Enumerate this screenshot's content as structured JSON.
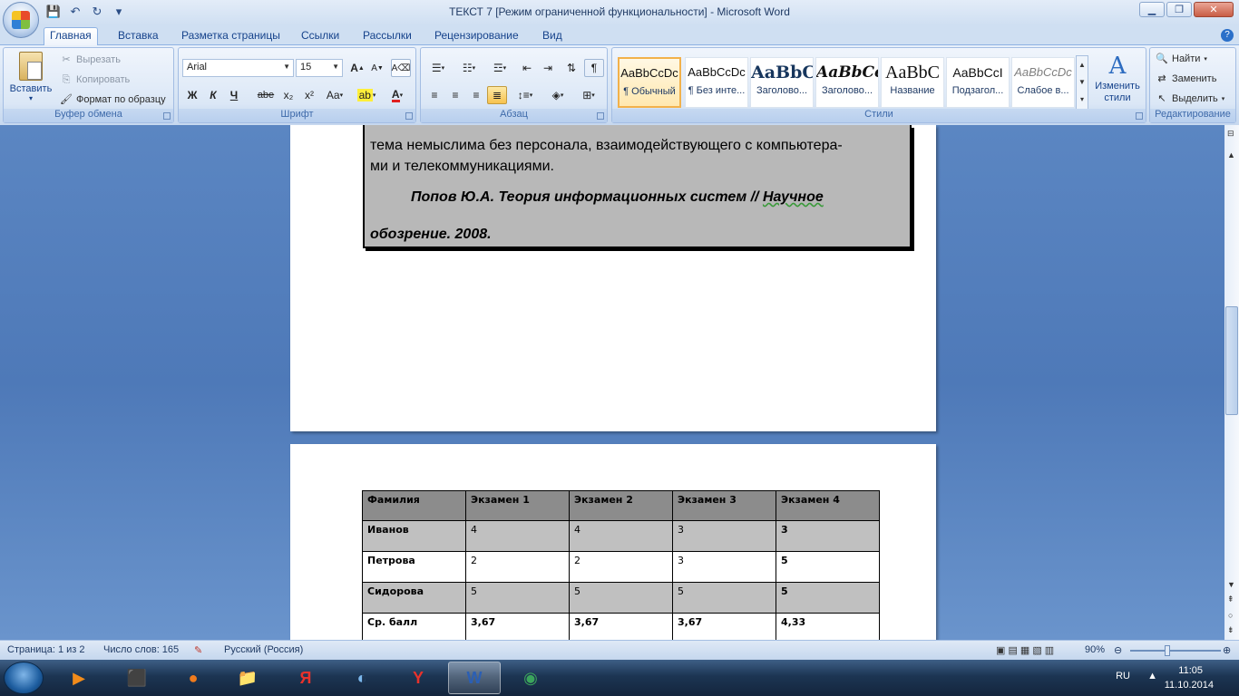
{
  "window": {
    "title": "ТЕКСТ 7 [Режим ограниченной функциональности] - Microsoft Word"
  },
  "qat": {
    "save": "💾",
    "undo": "↶",
    "redo": "↻",
    "more": "▾"
  },
  "tabs": [
    "Главная",
    "Вставка",
    "Разметка страницы",
    "Ссылки",
    "Рассылки",
    "Рецензирование",
    "Вид"
  ],
  "clipboard": {
    "paste": "Вставить",
    "cut": "Вырезать",
    "copy": "Копировать",
    "format_painter": "Формат по образцу",
    "label": "Буфер обмена"
  },
  "font": {
    "name": "Arial",
    "size": "15",
    "label": "Шрифт",
    "bold": "Ж",
    "italic": "К",
    "underline": "Ч",
    "strike": "abe",
    "sub": "x₂",
    "sup": "x²",
    "case": "Aa",
    "grow": "A",
    "shrink": "A"
  },
  "paragraph": {
    "label": "Абзац",
    "pilcrow": "¶"
  },
  "styles": {
    "label": "Стили",
    "change": "Изменить стили",
    "items": [
      {
        "sample": "AaBbCcDc",
        "name": "¶ Обычный"
      },
      {
        "sample": "AaBbCcDc",
        "name": "¶ Без инте..."
      },
      {
        "sample": "AaBbC",
        "name": "Заголово..."
      },
      {
        "sample": "AaBbCc",
        "name": "Заголово..."
      },
      {
        "sample": "AaBbC",
        "name": "Название"
      },
      {
        "sample": "AaBbCcI",
        "name": "Подзагол..."
      },
      {
        "sample": "AaBbCcDc",
        "name": "Слабое в..."
      }
    ]
  },
  "editing": {
    "find": "Найти",
    "replace": "Заменить",
    "select": "Выделить",
    "label": "Редактирование"
  },
  "document": {
    "quote_line1": "тема немыслима без персонала, взаимодействующего с компьютера-",
    "quote_line2": "ми и телекоммуникациями.",
    "ref_part1": "Попов Ю.А. Теория информационных систем // ",
    "ref_part2": "Научное",
    "ref_line2": "обозрение. 2008.",
    "table": {
      "headers": [
        "Фамилия",
        "Экзамен 1",
        "Экзамен 2",
        "Экзамен 3",
        "Экзамен 4"
      ],
      "rows": [
        [
          "Иванов",
          "4",
          "4",
          "3",
          "3"
        ],
        [
          "Петрова",
          "2",
          "2",
          "3",
          "5"
        ],
        [
          "Сидорова",
          "5",
          "5",
          "5",
          "5"
        ],
        [
          "Ср.  балл",
          "3,67",
          "3,67",
          "3,67",
          "4,33"
        ]
      ]
    }
  },
  "status": {
    "page": "Страница: 1 из 2",
    "words": "Число слов: 165",
    "lang": "Русский (Россия)",
    "zoom": "90%"
  },
  "taskbar": {
    "lang": "RU",
    "time": "11:05",
    "date": "11.10.2014"
  }
}
